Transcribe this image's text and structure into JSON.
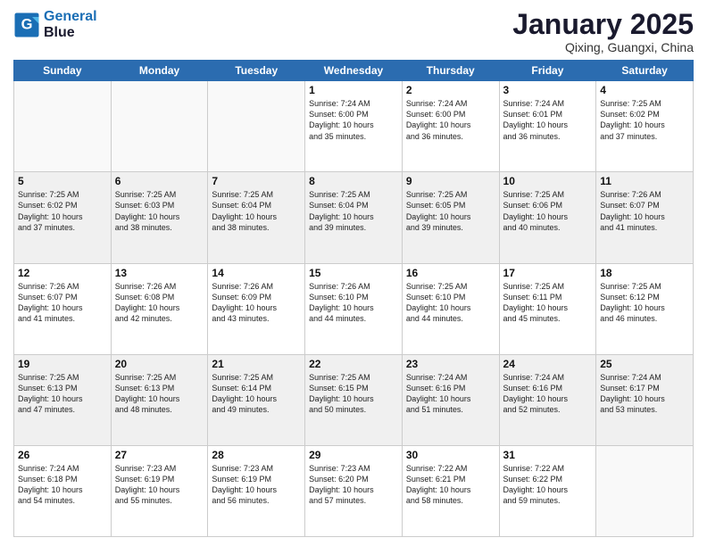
{
  "header": {
    "logo_line1": "General",
    "logo_line2": "Blue",
    "month_title": "January 2025",
    "location": "Qixing, Guangxi, China"
  },
  "weekdays": [
    "Sunday",
    "Monday",
    "Tuesday",
    "Wednesday",
    "Thursday",
    "Friday",
    "Saturday"
  ],
  "weeks": [
    [
      {
        "day": "",
        "info": ""
      },
      {
        "day": "",
        "info": ""
      },
      {
        "day": "",
        "info": ""
      },
      {
        "day": "1",
        "info": "Sunrise: 7:24 AM\nSunset: 6:00 PM\nDaylight: 10 hours\nand 35 minutes."
      },
      {
        "day": "2",
        "info": "Sunrise: 7:24 AM\nSunset: 6:00 PM\nDaylight: 10 hours\nand 36 minutes."
      },
      {
        "day": "3",
        "info": "Sunrise: 7:24 AM\nSunset: 6:01 PM\nDaylight: 10 hours\nand 36 minutes."
      },
      {
        "day": "4",
        "info": "Sunrise: 7:25 AM\nSunset: 6:02 PM\nDaylight: 10 hours\nand 37 minutes."
      }
    ],
    [
      {
        "day": "5",
        "info": "Sunrise: 7:25 AM\nSunset: 6:02 PM\nDaylight: 10 hours\nand 37 minutes."
      },
      {
        "day": "6",
        "info": "Sunrise: 7:25 AM\nSunset: 6:03 PM\nDaylight: 10 hours\nand 38 minutes."
      },
      {
        "day": "7",
        "info": "Sunrise: 7:25 AM\nSunset: 6:04 PM\nDaylight: 10 hours\nand 38 minutes."
      },
      {
        "day": "8",
        "info": "Sunrise: 7:25 AM\nSunset: 6:04 PM\nDaylight: 10 hours\nand 39 minutes."
      },
      {
        "day": "9",
        "info": "Sunrise: 7:25 AM\nSunset: 6:05 PM\nDaylight: 10 hours\nand 39 minutes."
      },
      {
        "day": "10",
        "info": "Sunrise: 7:25 AM\nSunset: 6:06 PM\nDaylight: 10 hours\nand 40 minutes."
      },
      {
        "day": "11",
        "info": "Sunrise: 7:26 AM\nSunset: 6:07 PM\nDaylight: 10 hours\nand 41 minutes."
      }
    ],
    [
      {
        "day": "12",
        "info": "Sunrise: 7:26 AM\nSunset: 6:07 PM\nDaylight: 10 hours\nand 41 minutes."
      },
      {
        "day": "13",
        "info": "Sunrise: 7:26 AM\nSunset: 6:08 PM\nDaylight: 10 hours\nand 42 minutes."
      },
      {
        "day": "14",
        "info": "Sunrise: 7:26 AM\nSunset: 6:09 PM\nDaylight: 10 hours\nand 43 minutes."
      },
      {
        "day": "15",
        "info": "Sunrise: 7:26 AM\nSunset: 6:10 PM\nDaylight: 10 hours\nand 44 minutes."
      },
      {
        "day": "16",
        "info": "Sunrise: 7:25 AM\nSunset: 6:10 PM\nDaylight: 10 hours\nand 44 minutes."
      },
      {
        "day": "17",
        "info": "Sunrise: 7:25 AM\nSunset: 6:11 PM\nDaylight: 10 hours\nand 45 minutes."
      },
      {
        "day": "18",
        "info": "Sunrise: 7:25 AM\nSunset: 6:12 PM\nDaylight: 10 hours\nand 46 minutes."
      }
    ],
    [
      {
        "day": "19",
        "info": "Sunrise: 7:25 AM\nSunset: 6:13 PM\nDaylight: 10 hours\nand 47 minutes."
      },
      {
        "day": "20",
        "info": "Sunrise: 7:25 AM\nSunset: 6:13 PM\nDaylight: 10 hours\nand 48 minutes."
      },
      {
        "day": "21",
        "info": "Sunrise: 7:25 AM\nSunset: 6:14 PM\nDaylight: 10 hours\nand 49 minutes."
      },
      {
        "day": "22",
        "info": "Sunrise: 7:25 AM\nSunset: 6:15 PM\nDaylight: 10 hours\nand 50 minutes."
      },
      {
        "day": "23",
        "info": "Sunrise: 7:24 AM\nSunset: 6:16 PM\nDaylight: 10 hours\nand 51 minutes."
      },
      {
        "day": "24",
        "info": "Sunrise: 7:24 AM\nSunset: 6:16 PM\nDaylight: 10 hours\nand 52 minutes."
      },
      {
        "day": "25",
        "info": "Sunrise: 7:24 AM\nSunset: 6:17 PM\nDaylight: 10 hours\nand 53 minutes."
      }
    ],
    [
      {
        "day": "26",
        "info": "Sunrise: 7:24 AM\nSunset: 6:18 PM\nDaylight: 10 hours\nand 54 minutes."
      },
      {
        "day": "27",
        "info": "Sunrise: 7:23 AM\nSunset: 6:19 PM\nDaylight: 10 hours\nand 55 minutes."
      },
      {
        "day": "28",
        "info": "Sunrise: 7:23 AM\nSunset: 6:19 PM\nDaylight: 10 hours\nand 56 minutes."
      },
      {
        "day": "29",
        "info": "Sunrise: 7:23 AM\nSunset: 6:20 PM\nDaylight: 10 hours\nand 57 minutes."
      },
      {
        "day": "30",
        "info": "Sunrise: 7:22 AM\nSunset: 6:21 PM\nDaylight: 10 hours\nand 58 minutes."
      },
      {
        "day": "31",
        "info": "Sunrise: 7:22 AM\nSunset: 6:22 PM\nDaylight: 10 hours\nand 59 minutes."
      },
      {
        "day": "",
        "info": ""
      }
    ]
  ]
}
